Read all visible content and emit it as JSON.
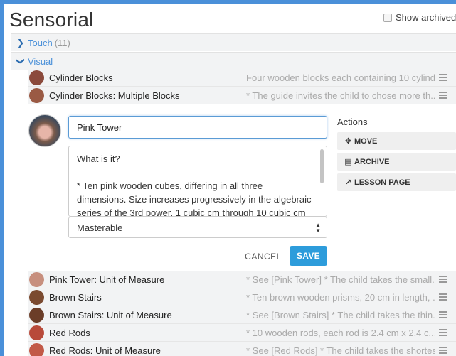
{
  "page": {
    "title": "Sensorial",
    "show_archived_label": "Show archived"
  },
  "categories": [
    {
      "label": "Touch",
      "count": "(11)"
    },
    {
      "label": "Visual",
      "count": ""
    }
  ],
  "items_above": [
    {
      "name": "Cylinder Blocks",
      "desc": "Four wooden blocks each containing 10 cylind...",
      "thumb": "#8b4a3c"
    },
    {
      "name": "Cylinder Blocks: Multiple Blocks",
      "desc": "* The guide invites the child to chose more th...",
      "thumb": "#9a5a44"
    }
  ],
  "editor": {
    "name_value": "Pink Tower",
    "description_value": "What is it?\n\n* Ten pink wooden cubes, differing in all three dimensions. Size increases progressively in the algebraic series of the 3rd power, 1 cubic cm through 10 cubic cm",
    "select_value": "Masterable",
    "cancel_label": "CANCEL",
    "save_label": "SAVE",
    "actions_title": "Actions",
    "actions": [
      {
        "label": "MOVE",
        "icon": "move-icon",
        "glyph": "✥"
      },
      {
        "label": "ARCHIVE",
        "icon": "archive-icon",
        "glyph": "▤"
      },
      {
        "label": "LESSON PAGE",
        "icon": "external-link-icon",
        "glyph": "↗"
      }
    ]
  },
  "items_below": [
    {
      "name": "Pink Tower: Unit of Measure",
      "desc": "* See [Pink Tower] * The child takes the small...",
      "thumb": "#c78f7e"
    },
    {
      "name": "Brown Stairs",
      "desc": "* Ten brown wooden prisms, 20 cm in length, ...",
      "thumb": "#7a4a30"
    },
    {
      "name": "Brown Stairs: Unit of Measure",
      "desc": "* See [Brown Stairs] * The child takes the thin...",
      "thumb": "#6b3d28"
    },
    {
      "name": "Red Rods",
      "desc": "* 10 wooden rods, each rod is 2.4 cm x 2.4 c...",
      "thumb": "#b84a3a"
    },
    {
      "name": "Red Rods: Unit of Measure",
      "desc": "* See [Red Rods] * The child takes the shortes...",
      "thumb": "#c25a48"
    }
  ],
  "colors": {
    "accent": "#4a90d9",
    "save": "#2d9cdb",
    "row_bg": "#f2f3f4"
  }
}
